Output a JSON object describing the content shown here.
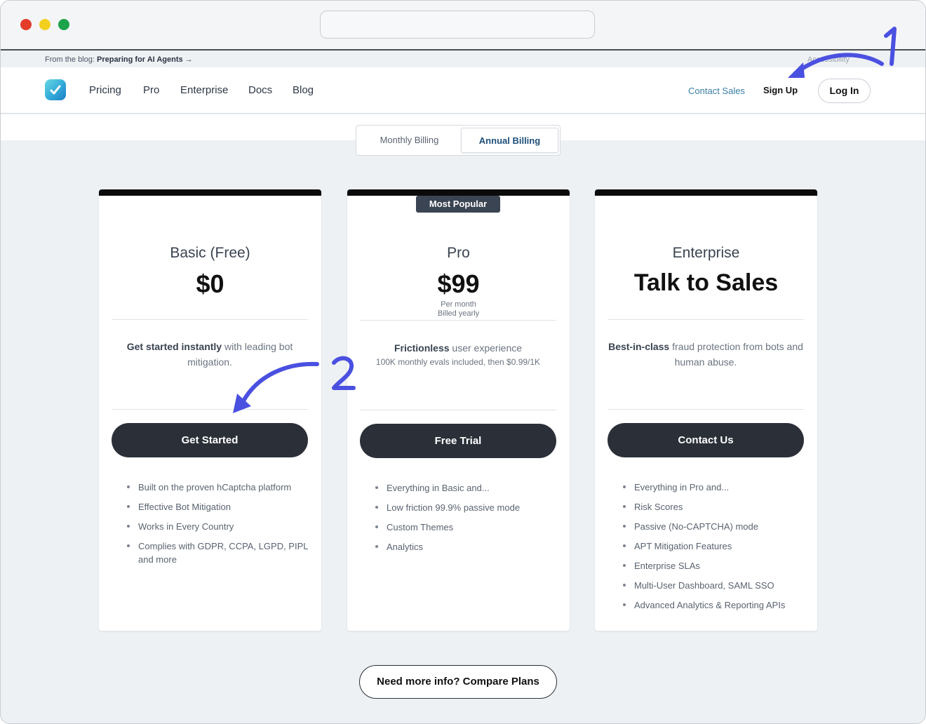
{
  "announcement": {
    "prefix": "From the blog: ",
    "link": "Preparing for AI Agents →",
    "accessibility": "Accessibility"
  },
  "nav": {
    "links": [
      "Pricing",
      "Pro",
      "Enterprise",
      "Docs",
      "Blog"
    ],
    "contact_sales": "Contact Sales",
    "sign_up": "Sign Up",
    "log_in": "Log In"
  },
  "billing": {
    "monthly": "Monthly Billing",
    "annual": "Annual Billing",
    "selected": "Annual Billing"
  },
  "plans": [
    {
      "title": "Basic (Free)",
      "price": "$0",
      "desc_bold": "Get started instantly",
      "desc_rest": " with leading bot mitigation.",
      "cta": "Get Started",
      "features": [
        "Built on the proven hCaptcha platform",
        "Effective Bot Mitigation",
        "Works in Every Country",
        "Complies with GDPR, CCPA, LGPD, PIPL and more"
      ]
    },
    {
      "title": "Pro",
      "badge": "Most Popular",
      "price": "$99",
      "price_sub1": "Per month",
      "price_sub2": "Billed yearly",
      "desc_bold": "Frictionless",
      "desc_rest": " user experience",
      "desc_line2": "100K monthly evals included, then $0.99/1K",
      "cta": "Free Trial",
      "features": [
        "Everything in Basic and...",
        "Low friction 99.9% passive mode",
        "Custom Themes",
        "Analytics"
      ]
    },
    {
      "title": "Enterprise",
      "price": "Talk to Sales",
      "desc_bold": "Best-in-class",
      "desc_rest": " fraud protection from bots and human abuse.",
      "cta": "Contact Us",
      "features": [
        "Everything in Pro and...",
        "Risk Scores",
        "Passive (No-CAPTCHA) mode",
        "APT Mitigation Features",
        "Enterprise SLAs",
        "Multi-User Dashboard, SAML SSO",
        "Advanced Analytics & Reporting APIs"
      ]
    }
  ],
  "compare_button": "Need more info? Compare Plans",
  "annotations": {
    "marker_1": "1",
    "marker_2": "2",
    "color": "#4a50e0"
  },
  "colors": {
    "button_dark": "#2a2f38",
    "card_top_bar": "#0b0b0b",
    "link_blue": "#3b7ea3"
  }
}
